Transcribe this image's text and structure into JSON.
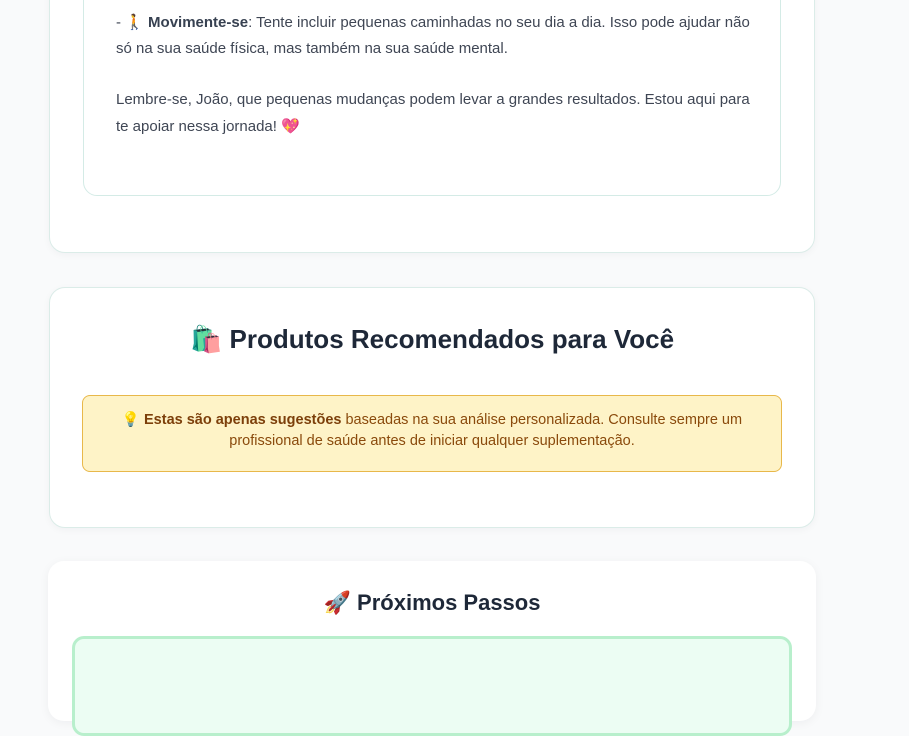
{
  "analysis": {
    "move_prefix": "- ",
    "move_icon": "🚶",
    "move_title": "Movimente-se",
    "move_text": ": Tente incluir pequenas caminhadas no seu dia a dia. Isso pode ajudar não só na sua saúde física, mas também na sua saúde mental.",
    "closing_text": "Lembre-se, João, que pequenas mudanças podem levar a grandes resultados. Estou aqui para te apoiar nessa jornada! ",
    "closing_icon": "💖"
  },
  "products": {
    "title_icon": "🛍️",
    "title": "Produtos Recomendados para Você",
    "notice_icon": "💡",
    "notice_bold": "Estas são apenas sugestões",
    "notice_text": " baseadas na sua análise personalizada. Consulte sempre um profissional de saúde antes de iniciar qualquer suplementação."
  },
  "steps": {
    "title_icon": "🚀",
    "title": "Próximos Passos"
  },
  "colors": {
    "notice_bg": "#fef3c7",
    "notice_border": "#e8b84a",
    "steps_box_bg": "#ecfdf3",
    "steps_box_border": "#b8efcc"
  }
}
